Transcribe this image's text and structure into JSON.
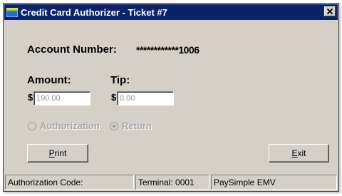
{
  "window": {
    "title": "Credit Card Authorizer - Ticket #7",
    "close_glyph": "✕"
  },
  "account": {
    "label": "Account Number:",
    "value": "************1006"
  },
  "amount": {
    "label": "Amount:",
    "currency": "$",
    "value": "190.00"
  },
  "tip": {
    "label": "Tip:",
    "currency": "$",
    "placeholder": "0.00"
  },
  "mode": {
    "options": [
      {
        "label": "Authorization",
        "mnemonic": "A",
        "rest": "uthorization",
        "selected": false
      },
      {
        "label": "Return",
        "mnemonic": "R",
        "rest": "eturn",
        "selected": true
      }
    ],
    "enabled": false
  },
  "buttons": {
    "print": {
      "label": "Print",
      "mnemonic": "P",
      "rest": "rint"
    },
    "exit": {
      "label": "Exit",
      "mnemonic": "E",
      "rest": "xit"
    }
  },
  "status": {
    "auth_code": "Authorization Code:",
    "terminal": "Terminal: 0001",
    "processor": "PaySimple EMV"
  },
  "colors": {
    "titlebar": "#0a246a",
    "window_face": "#d4d0c8",
    "disabled_text": "#a8a8a8"
  },
  "icons": {
    "app": "credit-card-icon",
    "close": "close-icon"
  }
}
